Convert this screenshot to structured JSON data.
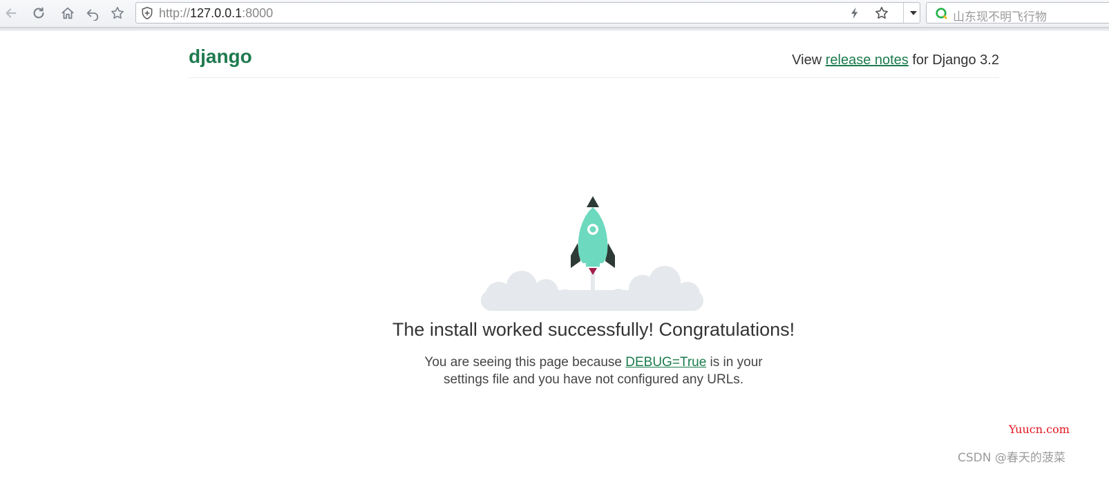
{
  "browser": {
    "url_scheme": "http://",
    "url_host": "127.0.0.1",
    "url_port": ":8000",
    "search_placeholder": "山东现不明飞行物"
  },
  "header": {
    "logo": "django",
    "release_prefix": "View ",
    "release_link": "release notes",
    "release_suffix": " for Django 3.2"
  },
  "main": {
    "headline": "The install worked successfully! Congratulations!",
    "sub_prefix": "You are seeing this page because ",
    "debug_link": "DEBUG=True",
    "sub_suffix_line1": " is in your",
    "sub_line2": "settings file and you have not configured any URLs."
  },
  "watermarks": {
    "site": "Yuucn.com",
    "author": "CSDN @春天的菠菜"
  },
  "colors": {
    "brand_green": "#1f7a4f",
    "link_green": "#1a7b4c",
    "rocket_body": "#6dd9be",
    "rocket_dark": "#2d3a36",
    "flame": "#a31d48",
    "cloud": "#e5e8ec"
  }
}
